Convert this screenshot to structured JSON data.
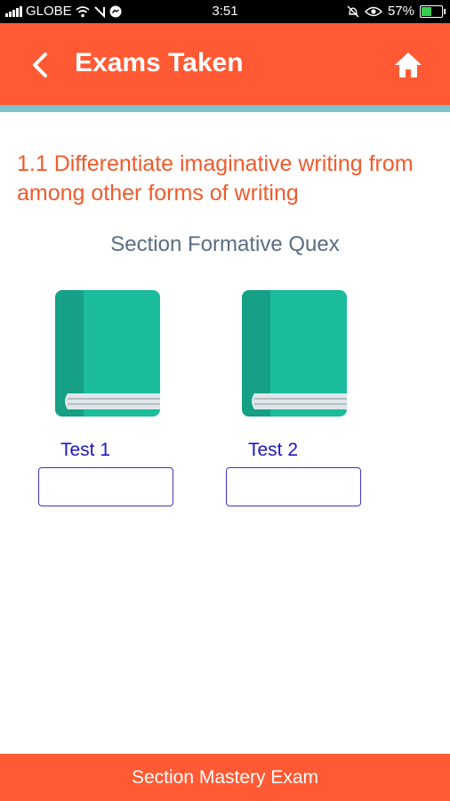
{
  "status_bar": {
    "carrier": "GLOBE",
    "time": "3:51",
    "battery": "57%",
    "battery_level": 0.57,
    "icons": [
      "signal-icon",
      "wifi-icon",
      "nfc-icon",
      "messenger-icon",
      "alarm-off-icon",
      "eye-icon",
      "battery-icon"
    ]
  },
  "app_bar": {
    "title": "Exams Taken",
    "back_icon": "back-chevron-icon",
    "home_icon": "home-icon"
  },
  "colors": {
    "accent": "#ff5a33",
    "heading": "#f25a2c",
    "book": "#1abc9c",
    "book_spine": "#16a085",
    "test_label": "#1a16c8"
  },
  "content": {
    "heading": "1.1 Differentiate imaginative writing from among other forms of writing",
    "section_label": "Section Formative Quex",
    "tests": [
      {
        "label": "Test 1",
        "score": ""
      },
      {
        "label": "Test 2",
        "score": ""
      }
    ]
  },
  "footer": {
    "label": "Section Mastery Exam"
  }
}
